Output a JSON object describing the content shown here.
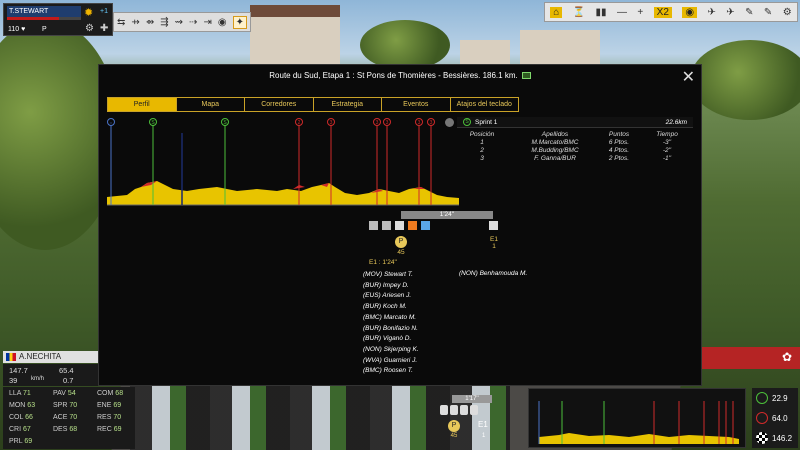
{
  "rider_card": {
    "name": "T.STEWART",
    "gains": "+1",
    "stat1": "110",
    "stat2": "P"
  },
  "orders": [
    "⇆",
    "⇸",
    "⇴",
    "⇶",
    "⇝",
    "⇢",
    "⇥",
    "◉",
    "✦"
  ],
  "controls": [
    "⌂",
    "⏳",
    "▮▮",
    "—",
    "+",
    "X2",
    "◉",
    "✈",
    "✈",
    "✎",
    "✎",
    "⚙"
  ],
  "bottom_left": {
    "name": "A.NECHITA",
    "values": {
      "a": "147.7",
      "b": "65.4",
      "c": "39",
      "unit": "km/h",
      "d": "0.7"
    },
    "attributes": [
      [
        "LLA",
        "71",
        "PAV",
        "54",
        "COM",
        "68"
      ],
      [
        "MON",
        "63",
        "SPR",
        "70",
        "ENE",
        "69"
      ],
      [
        "COL",
        "66",
        "ACE",
        "70",
        "RES",
        "70"
      ],
      [
        "CRI",
        "67",
        "DES",
        "68",
        "REC",
        "69"
      ],
      [
        "PRL",
        "69",
        "",
        "",
        "",
        ""
      ]
    ]
  },
  "mini_group": {
    "time": "1'17''",
    "p": "P",
    "p_num": "45",
    "e": "E1",
    "e_num": "1"
  },
  "right_stats": {
    "a": "22.9",
    "b": "64.0",
    "c": "146.2"
  },
  "modal": {
    "title": "Route du Sud, Etapa 1 : St Pons de Thomières - Bessières. 186.1 km.",
    "tabs": [
      "Perfil",
      "Mapa",
      "Corredores",
      "Estrategia",
      "Eventos",
      "Atajos del teclado"
    ],
    "active_tab": "Perfil",
    "sprint": {
      "label": "Sprint 1",
      "km": "22.6km",
      "headers": [
        "Posición",
        "Apellidos",
        "Puntos",
        "Tiempo"
      ],
      "rows": [
        [
          "1",
          "M.Marcato/BMC",
          "6 Ptos.",
          "-3''"
        ],
        [
          "2",
          "M.Budding/BMC",
          "4 Ptos.",
          "-2''"
        ],
        [
          "3",
          "F. Ganna/BUR",
          "2 Ptos.",
          "-1''"
        ]
      ]
    },
    "profile": {
      "markers": [
        {
          "label": "○",
          "color": "#4a73c7"
        },
        {
          "label": "S",
          "color": "#4cbf3a"
        },
        {
          "label": "S",
          "color": "#4cbf3a"
        },
        {
          "label": "2",
          "color": "#d02a2a"
        },
        {
          "label": "3",
          "color": "#d02a2a"
        },
        {
          "label": "3",
          "color": "#d02a2a"
        },
        {
          "label": "3",
          "color": "#d02a2a"
        },
        {
          "label": "3",
          "color": "#d02a2a"
        },
        {
          "label": "3",
          "color": "#d02a2a"
        }
      ]
    },
    "gap_label": "1'24''",
    "p_badge": "P",
    "p_num": "45",
    "e1_label": "E1",
    "e1_num": "1",
    "e1_time": "E1 : 1'24''",
    "group_a": [
      "(MOV) Stewart T.",
      "(BUR) Impey D.",
      "(EUS) Ariesen J.",
      "(BUR) Koch M.",
      "(BMC) Marcato M.",
      "(BUR) Bonifazio N.",
      "(BUR) Viganò D.",
      "(NON) Skjerping K.",
      "(WVA) Guarnieri J.",
      "(BMC) Roosen T."
    ],
    "group_b": [
      "(NON) Benhamouda M."
    ]
  },
  "colors": {
    "accent": "#e8b800",
    "sprint": "#4cbf3a",
    "climb": "#d02a2a",
    "profile": "#e8c400"
  }
}
